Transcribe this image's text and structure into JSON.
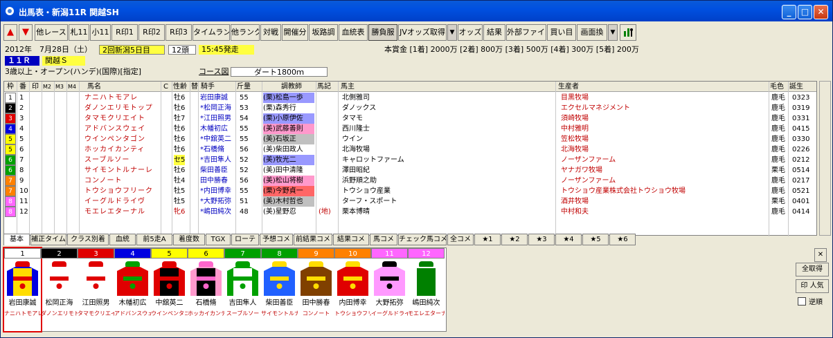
{
  "window": {
    "title": "出馬表・新潟11R 関越SH",
    "btn_min": "_",
    "btn_max": "□",
    "btn_close": "✕"
  },
  "toolbar": {
    "up": "▲",
    "down": "▼",
    "buttons": [
      "他レース",
      "札11",
      "小11",
      "R印1",
      "R印2",
      "R印3",
      "タイムランク",
      "他ランク",
      "対戦",
      "開催分",
      "坂路調",
      "血統表",
      "勝負服",
      "JVオッズ取得",
      "オッズ",
      "結果",
      "外部ファイル",
      "買い目",
      "画面換"
    ],
    "dd": "▼"
  },
  "race": {
    "date": "2012年　7月28日（土）",
    "kaisai": "2回新潟5日目",
    "heads": "12頭",
    "start": "15:45発走",
    "prize": "本賞金 [1着] 2000万 [2着] 800万 [3着] 500万 [4着] 300万 [5着] 200万",
    "rno": "１１Ｒ",
    "name": "関越Ｓ",
    "cond": "3歳以上・オープン(ハンデ)(国際)[指定]",
    "course_label": "コース図",
    "course": "ダート1800ｍ"
  },
  "table": {
    "headers": {
      "waku": "枠",
      "ban": "番",
      "mark": "印",
      "m2": "M2",
      "m3": "M3",
      "m4": "M4",
      "horse": "馬名",
      "c": "C",
      "sexage": "性齢",
      "blink": "替",
      "jockey": "騎手",
      "weight": "斤量",
      "trainer": "調教師",
      "note": "馬記",
      "owner": "馬主",
      "breeder": "生産者",
      "color": "毛色",
      "birth": "誕生"
    },
    "rows": [
      {
        "waku": "1",
        "ban": "1",
        "horse": "ナニハトモアレ",
        "sexage": "牡6",
        "jockey": "岩田康誠",
        "weight": "55",
        "trainer": "(栗)松島一歩",
        "owner": "北側雅司",
        "breeder": "目黒牧場",
        "color": "鹿毛",
        "birth": "0323"
      },
      {
        "waku": "2",
        "ban": "2",
        "horse": "ダノンエリモトップ",
        "sexage": "牡6",
        "jockey": "*松岡正海",
        "weight": "53",
        "trainer": "(栗)森秀行",
        "owner": "ダノックス",
        "breeder": "エクセルマネジメント",
        "color": "鹿毛",
        "birth": "0319"
      },
      {
        "waku": "3",
        "ban": "3",
        "horse": "タマモクリエイト",
        "sexage": "牡7",
        "jockey": "*江田照男",
        "weight": "54",
        "trainer": "(栗)小原伊佐",
        "owner": "タマモ",
        "breeder": "須崎牧場",
        "color": "鹿毛",
        "birth": "0331"
      },
      {
        "waku": "4",
        "ban": "4",
        "horse": "アドバンスウェイ",
        "sexage": "牡6",
        "jockey": "木幡初広",
        "weight": "55",
        "trainer": "(美)武藤善則",
        "owner": "西川隆士",
        "breeder": "中村雅明",
        "color": "鹿毛",
        "birth": "0415"
      },
      {
        "waku": "5",
        "ban": "5",
        "horse": "ウインペンタゴン",
        "sexage": "牡6",
        "jockey": "*中舘英二",
        "weight": "55",
        "trainer": "(美)石坂正",
        "owner": "ウイン",
        "breeder": "笠松牧場",
        "color": "鹿毛",
        "birth": "0330"
      },
      {
        "waku": "5",
        "ban": "6",
        "horse": "ホッカイカンティ",
        "sexage": "牡6",
        "jockey": "*石橋脩",
        "weight": "56",
        "trainer": "(美)柴田政人",
        "owner": "北海牧場",
        "breeder": "北海牧場",
        "color": "鹿毛",
        "birth": "0226"
      },
      {
        "waku": "6",
        "ban": "7",
        "horse": "スーブルソー",
        "sexage": "セ5",
        "jockey": "*吉田隼人",
        "weight": "52",
        "trainer": "(美)牧光二",
        "owner": "キャロットファーム",
        "breeder": "ノーザンファーム",
        "color": "鹿毛",
        "birth": "0212"
      },
      {
        "waku": "6",
        "ban": "8",
        "horse": "サイモントルナーレ",
        "sexage": "牡6",
        "jockey": "柴田善臣",
        "weight": "52",
        "trainer": "(美)田中清隆",
        "owner": "澤田昭紀",
        "breeder": "ヤナガワ牧場",
        "color": "栗毛",
        "birth": "0514"
      },
      {
        "waku": "7",
        "ban": "9",
        "horse": "コンノート",
        "sexage": "牡4",
        "jockey": "田中勝春",
        "weight": "56",
        "trainer": "(美)松山将樹",
        "owner": "浜野順之助",
        "breeder": "ノーザンファーム",
        "color": "鹿毛",
        "birth": "0217"
      },
      {
        "waku": "7",
        "ban": "10",
        "horse": "トウショウフリーク",
        "sexage": "牡5",
        "jockey": "*内田博幸",
        "weight": "55",
        "trainer": "(栗)今野貞一",
        "owner": "トウショウ産業",
        "breeder": "トウショウ産業株式会社トウショウ牧場",
        "color": "鹿毛",
        "birth": "0521"
      },
      {
        "waku": "8",
        "ban": "11",
        "horse": "イーグルドライヴ",
        "sexage": "牡5",
        "jockey": "*大野拓弥",
        "weight": "51",
        "trainer": "(美)木村哲也",
        "owner": "ターフ・スポート",
        "breeder": "酒井牧場",
        "color": "栗毛",
        "birth": "0401"
      },
      {
        "waku": "8",
        "ban": "12",
        "horse": "モエレエターナル",
        "sexage": "牝6",
        "jockey": "*嶋田純次",
        "weight": "48",
        "trainer": "(美)星野忍",
        "note": "(地)",
        "owner": "栗本博晴",
        "breeder": "中村和夫",
        "color": "鹿毛",
        "birth": "0414"
      }
    ]
  },
  "tabs": [
    "基本",
    "補正タイム",
    "クラス別着",
    "血統",
    "前5走A",
    "着度数",
    "TGX",
    "ローテ",
    "予想コメ",
    "前結果コメ",
    "結果コメ",
    "馬コメ",
    "チェック馬コメ",
    "全コメ",
    "★1",
    "★2",
    "★3",
    "★4",
    "★5",
    "★6"
  ],
  "silks": [
    {
      "num": "1",
      "jockey": "岩田康誠",
      "horse": "ナニハトモアレ"
    },
    {
      "num": "2",
      "jockey": "松岡正海",
      "horse": "ダノンエリモトップ"
    },
    {
      "num": "3",
      "jockey": "江田照男",
      "horse": "タマモクリエイト"
    },
    {
      "num": "4",
      "jockey": "木幡初広",
      "horse": "アドバンスウェイ"
    },
    {
      "num": "5",
      "jockey": "中舘英二",
      "horse": "ウインペンタゴン"
    },
    {
      "num": "6",
      "jockey": "石橋脩",
      "horse": "ホッカイカンティ"
    },
    {
      "num": "7",
      "jockey": "吉田隼人",
      "horse": "スーブルソー"
    },
    {
      "num": "8",
      "jockey": "柴田善臣",
      "horse": "サイモントルナーレ"
    },
    {
      "num": "9",
      "jockey": "田中勝春",
      "horse": "コンノート"
    },
    {
      "num": "10",
      "jockey": "内田博幸",
      "horse": "トウショウフリーク"
    },
    {
      "num": "11",
      "jockey": "大野拓弥",
      "horse": "イーグルドライヴ"
    },
    {
      "num": "12",
      "jockey": "嶋田純次",
      "horse": "モエレエターナル"
    }
  ],
  "side": {
    "close": "✕",
    "fetch": "全取得",
    "sort": "印 人気",
    "reverse": "逆順"
  },
  "colors": {
    "waku1": "#ffffff",
    "waku2": "#000000",
    "waku3": "#e00000",
    "waku4": "#0000e0",
    "waku5": "#ffff00",
    "waku6": "#00a000",
    "waku7": "#ff8000",
    "waku8": "#ff66ff"
  }
}
